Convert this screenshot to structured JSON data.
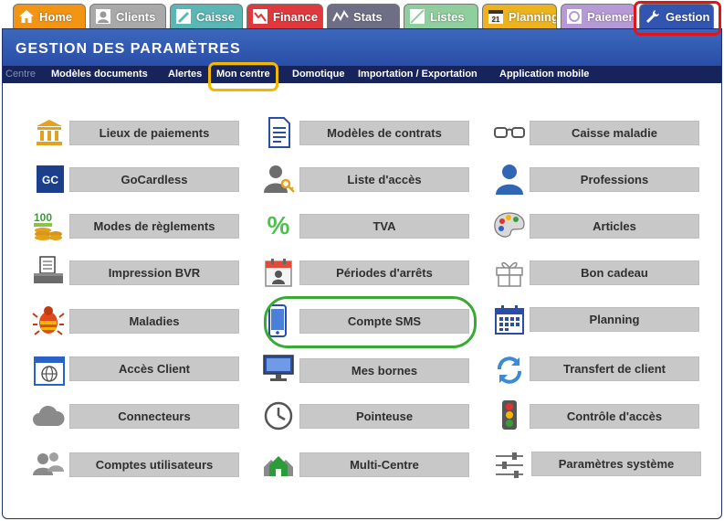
{
  "tabs": [
    {
      "label": "Home",
      "icon": "home-icon",
      "bg": "#f29414"
    },
    {
      "label": "Clients",
      "icon": "user-icon",
      "bg": "#a9a9a9"
    },
    {
      "label": "Caisse",
      "icon": "cash-register-icon",
      "bg": "#5bb7b5"
    },
    {
      "label": "Finance",
      "icon": "finance-chart-icon",
      "bg": "#e0393c"
    },
    {
      "label": "Stats",
      "icon": "stats-line-icon",
      "bg": "#6e6e87"
    },
    {
      "label": "Listes",
      "icon": "list-icon",
      "bg": "#8fcf9d"
    },
    {
      "label": "Planning",
      "icon": "calendar-icon",
      "bg": "#ecb31f"
    },
    {
      "label": "Paiements",
      "icon": "payment-card-icon",
      "bg": "#b69ad7"
    },
    {
      "label": "Gestion",
      "icon": "wrench-icon",
      "bg": "#3155b0"
    }
  ],
  "header": {
    "title": "GESTION DES PARAMÈTRES"
  },
  "subnav": [
    {
      "label": "Centre"
    },
    {
      "label": "Modèles documents"
    },
    {
      "label": "Alertes"
    },
    {
      "label": "Mon centre"
    },
    {
      "label": "Domotique"
    },
    {
      "label": "Importation / Exportation"
    },
    {
      "label": "Application mobile"
    }
  ],
  "grid": {
    "col1": [
      {
        "label": "Lieux de paiements",
        "icon": "bank-building-icon"
      },
      {
        "label": "GoCardless",
        "icon": "gocardless-logo-icon",
        "logo_text": "GC"
      },
      {
        "label": "Modes de règlements",
        "icon": "money-coins-icon",
        "icon_text": "100"
      },
      {
        "label": "Impression BVR",
        "icon": "printer-icon"
      },
      {
        "label": "Maladies",
        "icon": "bug-icon"
      },
      {
        "label": "Accès Client",
        "icon": "web-globe-icon"
      },
      {
        "label": "Connecteurs",
        "icon": "cloud-icon"
      },
      {
        "label": "Comptes utilisateurs",
        "icon": "users-group-icon"
      }
    ],
    "col2": [
      {
        "label": "Modèles de contrats",
        "icon": "contract-document-icon"
      },
      {
        "label": "Liste d'accès",
        "icon": "user-key-icon"
      },
      {
        "label": "TVA",
        "icon": "percent-icon",
        "icon_text": "%"
      },
      {
        "label": "Périodes d'arrêts",
        "icon": "calendar-person-icon"
      },
      {
        "label": "Compte SMS",
        "icon": "mobile-phone-icon"
      },
      {
        "label": "Mes bornes",
        "icon": "monitor-icon"
      },
      {
        "label": "Pointeuse",
        "icon": "clock-icon"
      },
      {
        "label": "Multi-Centre",
        "icon": "houses-icon"
      }
    ],
    "col3": [
      {
        "label": "Caisse maladie",
        "icon": "glasses-icon"
      },
      {
        "label": "Professions",
        "icon": "person-silhouette-icon"
      },
      {
        "label": "Articles",
        "icon": "palette-icon"
      },
      {
        "label": "Bon cadeau",
        "icon": "gift-icon"
      },
      {
        "label": "Planning",
        "icon": "calendar-grid-icon"
      },
      {
        "label": "Transfert de client",
        "icon": "sync-arrows-icon"
      },
      {
        "label": "Contrôle d'accès",
        "icon": "traffic-light-icon"
      },
      {
        "label": "Paramètres système",
        "icon": "sliders-icon"
      }
    ]
  },
  "colors": {
    "header_blue": "#2f56ae",
    "subnav_navy": "#17245c",
    "button_gray": "#c8c8c8",
    "highlight_red": "#e0141b",
    "highlight_yellow": "#f2b705",
    "highlight_green": "#3aaa35",
    "icon_gold": "#e3a21a"
  }
}
